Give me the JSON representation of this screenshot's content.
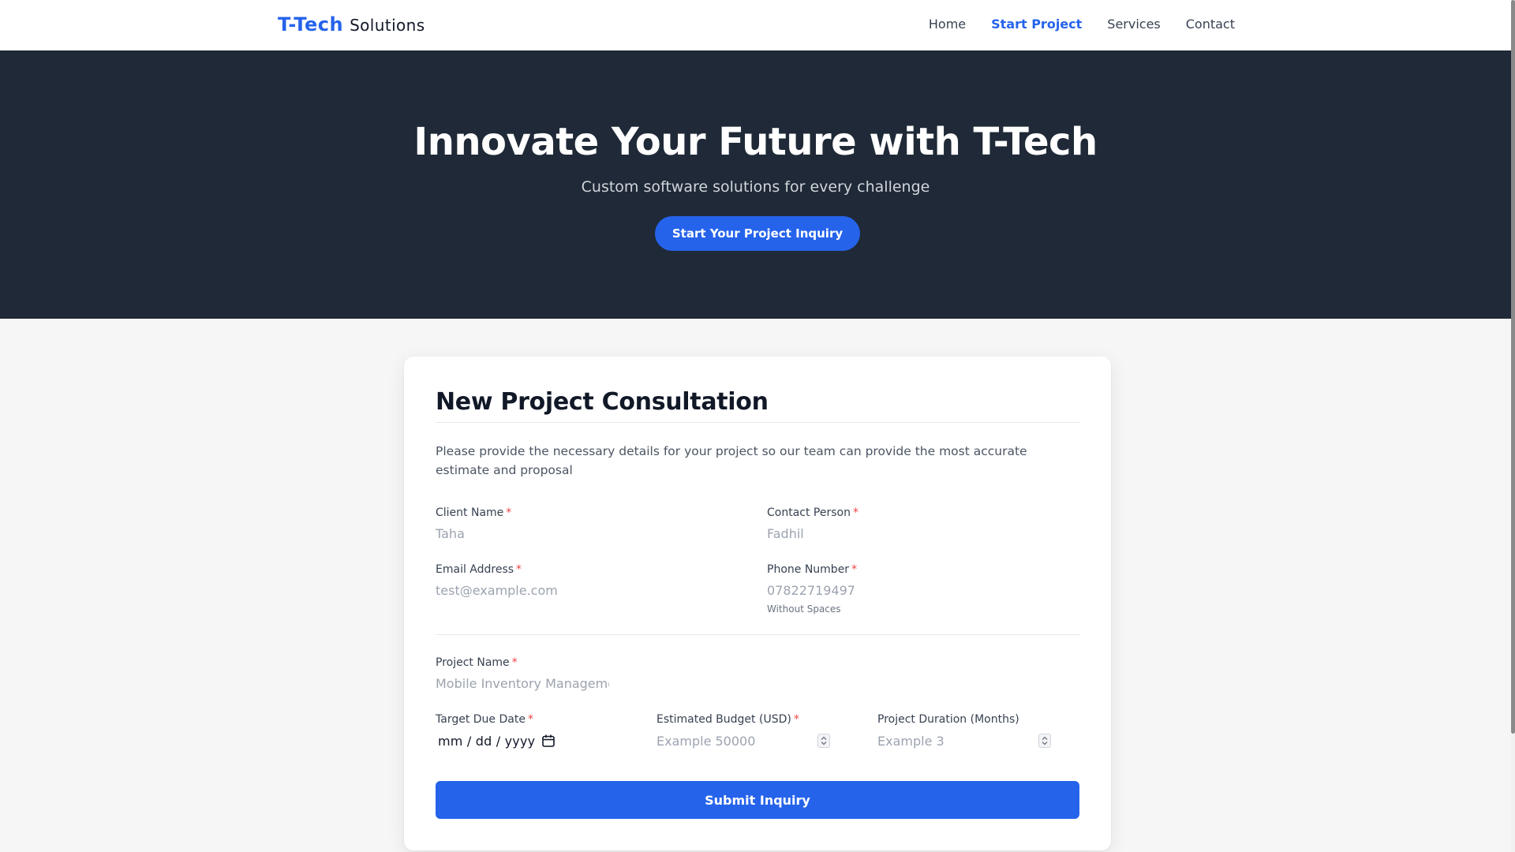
{
  "nav": {
    "brand_primary": "T-Tech",
    "brand_secondary": "Solutions",
    "links": [
      "Home",
      "Start Project",
      "Services",
      "Contact"
    ],
    "active_link": "Start Project"
  },
  "hero": {
    "title": "Innovate Your Future with T-Tech",
    "subtitle": "Custom software solutions for every challenge",
    "cta_label": "Start Your Project Inquiry"
  },
  "form": {
    "title": "New Project Consultation",
    "intro": "Please provide the necessary details for your project so our team can provide the most accurate estimate and proposal",
    "required_marker": "*",
    "client_name": {
      "label": "Client Name",
      "placeholder": "Taha",
      "value": ""
    },
    "contact_person": {
      "label": "Contact Person",
      "placeholder": "Fadhil",
      "value": ""
    },
    "email": {
      "label": "Email Address",
      "placeholder": "test@example.com",
      "value": ""
    },
    "phone": {
      "label": "Phone Number",
      "placeholder": "07822719497",
      "value": "",
      "hint": "Without Spaces"
    },
    "project_name": {
      "label": "Project Name",
      "placeholder": "Mobile Inventory Management",
      "value": ""
    },
    "due_date": {
      "label": "Target Due Date",
      "display": "mm / dd / yyyy"
    },
    "budget": {
      "label": "Estimated Budget (USD)",
      "placeholder": "Example 50000",
      "value": ""
    },
    "duration": {
      "label": "Project Duration (Months)",
      "placeholder": "Example 3",
      "value": ""
    },
    "submit_label": "Submit Inquiry"
  },
  "colors": {
    "accent": "#2563eb",
    "hero_bg": "#1f2937",
    "page_bg": "#f6f6f6",
    "required": "#ef4444"
  },
  "icons": [
    "calendar-icon",
    "spinner-up-down-icon"
  ]
}
